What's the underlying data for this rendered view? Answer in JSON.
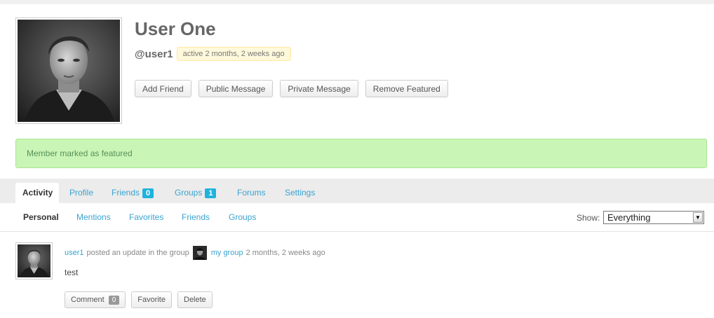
{
  "profile": {
    "name": "User One",
    "handle": "@user1",
    "active": "active 2 months, 2 weeks ago",
    "buttons": {
      "add_friend": "Add Friend",
      "public_message": "Public Message",
      "private_message": "Private Message",
      "remove_featured": "Remove Featured"
    }
  },
  "notice": "Member marked as featured",
  "tabs": {
    "activity": "Activity",
    "profile": "Profile",
    "friends": {
      "label": "Friends",
      "count": "0"
    },
    "groups": {
      "label": "Groups",
      "count": "1"
    },
    "forums": "Forums",
    "settings": "Settings"
  },
  "subnav": {
    "personal": "Personal",
    "mentions": "Mentions",
    "favorites": "Favorites",
    "friends": "Friends",
    "groups": "Groups",
    "show_label": "Show:",
    "show_value": "Everything"
  },
  "activity": {
    "user_link": "user1",
    "action_text": "posted an update in the group",
    "group_link": "my group",
    "time": "2 months, 2 weeks ago",
    "content": "test",
    "buttons": {
      "comment": "Comment",
      "comment_count": "0",
      "favorite": "Favorite",
      "delete": "Delete"
    }
  },
  "colors": {
    "link": "#3aa3d1",
    "count_badge": "#1fb3dd",
    "notice_bg": "#c9f5b6",
    "notice_text": "#58915a",
    "active_badge_bg": "#fff9db"
  },
  "icons": {
    "select_arrow": "chevron-down-icon"
  }
}
